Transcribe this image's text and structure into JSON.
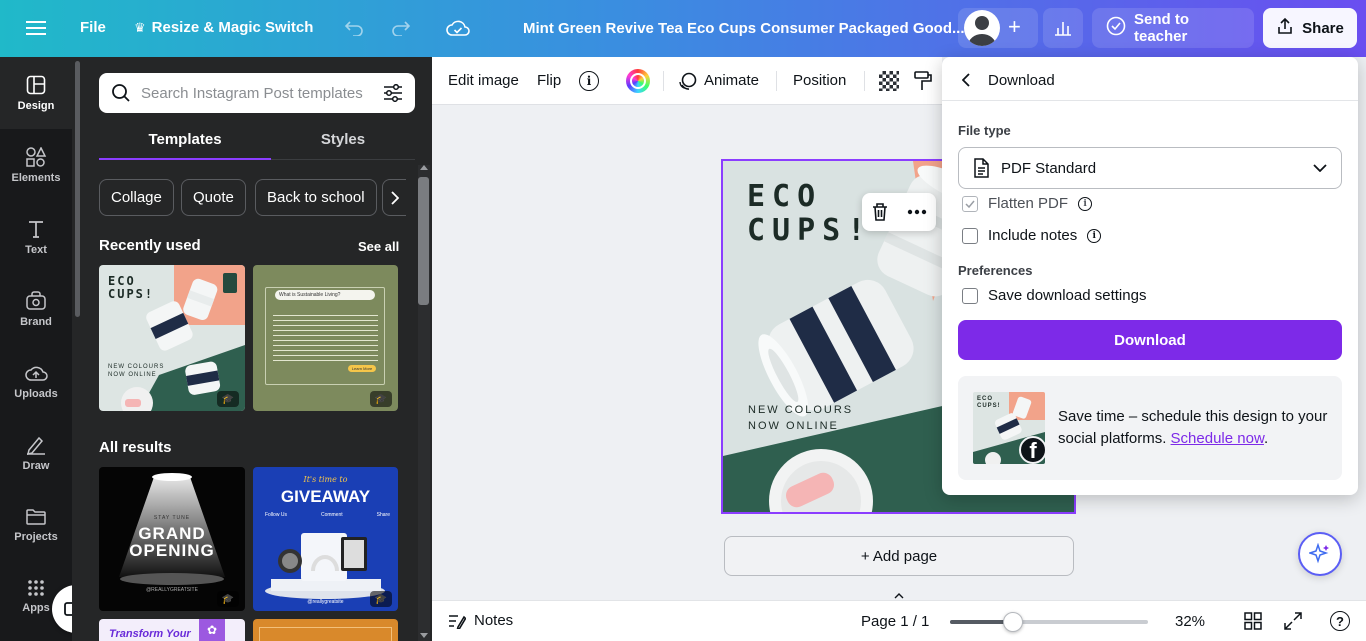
{
  "topbar": {
    "file": "File",
    "resize": "Resize & Magic Switch",
    "doc_title": "Mint Green Revive Tea Eco Cups Consumer Packaged Good...",
    "send_to_teacher": "Send to teacher",
    "share": "Share",
    "icons": [
      "menu-icon",
      "crown-icon",
      "undo-icon",
      "redo-icon",
      "cloud-saved-icon",
      "avatar",
      "plus-icon",
      "analytics-icon",
      "check-circle-icon",
      "share-icon"
    ]
  },
  "rail": {
    "items": [
      "Design",
      "Elements",
      "Text",
      "Brand",
      "Uploads",
      "Draw",
      "Projects",
      "Apps"
    ]
  },
  "panel": {
    "search_placeholder": "Search Instagram Post templates",
    "tabs": [
      "Templates",
      "Styles"
    ],
    "chips": [
      "Collage",
      "Quote",
      "Back to school"
    ],
    "recently_used": "Recently used",
    "see_all": "See all",
    "all_results": "All results",
    "thumb1": {
      "line1": "ECO",
      "line2": "CUPS!",
      "sub1": "NEW COLOURS",
      "sub2": "NOW ONLINE"
    },
    "thumb2": {
      "title": "What is Sustainable Living?",
      "btn": "Learn More"
    },
    "thumb3": {
      "tag": "STAY TUNE",
      "l1": "GRAND",
      "l2": "OPENING",
      "foot": "@REALLYGREATSITE"
    },
    "thumb4": {
      "tag": "It's time to",
      "title": "GIVEAWAY",
      "opts": [
        "Follow Us",
        "Comment",
        "Share"
      ],
      "foot": "@reallygreatsite"
    },
    "thumb5": {
      "title": "Transform Your"
    }
  },
  "toolbar2": {
    "edit_image": "Edit image",
    "flip": "Flip",
    "animate": "Animate",
    "position": "Position"
  },
  "design": {
    "line1": "ECO",
    "line2": "CUPS!",
    "sub1": "NEW COLOURS",
    "sub2": "NOW ONLINE"
  },
  "canvas": {
    "add_page": "+ Add page"
  },
  "download": {
    "header": "Download",
    "file_type_label": "File type",
    "file_type_value": "PDF Standard",
    "flatten_pdf": "Flatten PDF",
    "include_notes": "Include notes",
    "preferences_label": "Preferences",
    "save_settings": "Save download settings",
    "download_button": "Download",
    "promo_text": "Save time – schedule this design to your social platforms.",
    "promo_link": "Schedule now",
    "promo_end": "."
  },
  "bottombar": {
    "notes": "Notes",
    "page": "Page 1 / 1",
    "zoom": "32%",
    "zoom_fraction": 0.32
  },
  "colors": {
    "accent": "#8b3dff",
    "download_btn": "#7d2ae8",
    "rail_bg": "#18191b",
    "panel_bg": "#252627",
    "record": "#e02424",
    "mint": "#d9e2e1",
    "dark_green": "#2f5f4f",
    "peach": "#f2a38a"
  }
}
